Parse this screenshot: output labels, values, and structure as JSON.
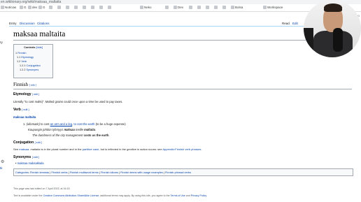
{
  "browser": {
    "url": "en.wiktionary.org/wiki/maksaa_maltaita",
    "bookmarks": [
      "Notícias",
      "G",
      "dev",
      "G",
      "",
      "",
      "",
      "",
      "",
      "",
      "",
      "",
      "Neko",
      "",
      "Dev",
      "",
      "",
      "",
      "",
      "",
      "",
      "Bolsa",
      "",
      "",
      "Workspace",
      "",
      "Buttyrallisa WFP",
      "",
      ""
    ]
  },
  "sidebar": {
    "left_label": "ry",
    "tools_icon": "gear-icon",
    "bottom_label": "Ik",
    "user_label": "No"
  },
  "tabs": {
    "left": [
      "Entry",
      "Discussion",
      "Citations"
    ],
    "right": [
      "Read",
      "Edit"
    ]
  },
  "page": {
    "title": "maksaa maltaita"
  },
  "toc": {
    "title": "Contents",
    "hide": "[hide]",
    "items": [
      {
        "num": "1",
        "text": "Finnish"
      },
      {
        "num": "1.1",
        "text": "Etymology"
      },
      {
        "num": "1.2",
        "text": "Verb"
      },
      {
        "num": "1.2.1",
        "text": "Conjugation"
      },
      {
        "num": "1.2.2",
        "text": "Synonyms"
      }
    ]
  },
  "sections": {
    "finnish": {
      "heading": "Finnish",
      "edit": "[ edit ]"
    },
    "etymology": {
      "heading": "Etymology",
      "edit": "[ edit ]",
      "text": "Literally \"to cost malts)\". Malted grains could once upon a time be used to pay taxes."
    },
    "verb": {
      "heading": "Verb",
      "edit": "[ edit ]",
      "headword": "maksaa maltaita",
      "def_num": "1.",
      "def_label": "(idiomatic)",
      "def_pre": " to cost ",
      "def_link1": "an arm and a leg",
      "def_mid": ", ",
      "def_link2": "to cost the earth",
      "def_post": " (to be a huge expense)",
      "example_fi_pre": "Kaupungin johdon tyhmyys ",
      "example_fi_bold1": "maksaa",
      "example_fi_mid": " meille ",
      "example_fi_bold2": "maltaita",
      "example_fi_end": ".",
      "example_en_pre": "The dumbness of the city management ",
      "example_en_bold": "costs us the earth",
      "example_en_end": "."
    },
    "conjugation": {
      "heading": "Conjugation",
      "edit": "[ edit ]",
      "pre": "See ",
      "link1": "maksaa",
      "mid1": ". ",
      "italic": "maltaita",
      "mid2": " is in the plural number and in the ",
      "link2": "partitive case",
      "mid3": ", but is inflected in the genitive in action nouns: see ",
      "link3": "Appendix:Finnish verb phrases",
      "end": "."
    },
    "synonyms": {
      "heading": "Synonyms",
      "edit": "[ edit ]",
      "item": "maksaa maksakkala"
    }
  },
  "categories": {
    "label": "Categories",
    "items": [
      "Finnish lemmas",
      "Finnish verbs",
      "Finnish multiword terms",
      "Finnish idioms",
      "Finnish terms with usage examples",
      "Finnish phrasal verbs"
    ]
  },
  "footer": {
    "last_edited": "This page was last edited on 7 April 2023, at 16:15.",
    "license_pre": "Text is available under the ",
    "license_link": "Creative Commons Attribution-ShareAlike License",
    "license_mid": "; additional terms may apply. By using this site, you agree to the ",
    "terms": "Terms of Use",
    "and": " and ",
    "privacy": "Privacy Policy",
    "end": "."
  }
}
